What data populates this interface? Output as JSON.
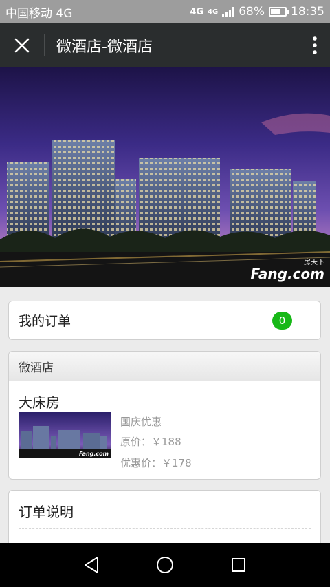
{
  "status_bar": {
    "carrier": "中国移动 4G",
    "network_1": "4G",
    "network_2": "4G",
    "battery_percent": "68%",
    "battery_level": 0.68,
    "time": "18:35"
  },
  "title_bar": {
    "title": "微酒店-微酒店",
    "close_icon": "close-icon",
    "more_icon": "more-vertical-icon"
  },
  "hero": {
    "image": "hotel-buildings-night-photo",
    "watermark_top": "房天下",
    "watermark_brand": "Fang.com"
  },
  "orders": {
    "label": "我的订单",
    "count": "0"
  },
  "hotel": {
    "header": "微酒店",
    "room_name": "大床房",
    "promo": "国庆优惠",
    "original_price": "原价：￥188",
    "discount_price": "优惠价：￥178",
    "thumb_brand": "Fang.com"
  },
  "order_desc": {
    "title": "订单说明"
  },
  "nav_bar": {
    "back_icon": "back-triangle-icon",
    "home_icon": "home-circle-icon",
    "recents_icon": "recents-square-icon"
  },
  "colors": {
    "title_bar_bg": "#2a2d2e",
    "badge_green": "#17b817",
    "page_bg": "#ebebeb"
  }
}
